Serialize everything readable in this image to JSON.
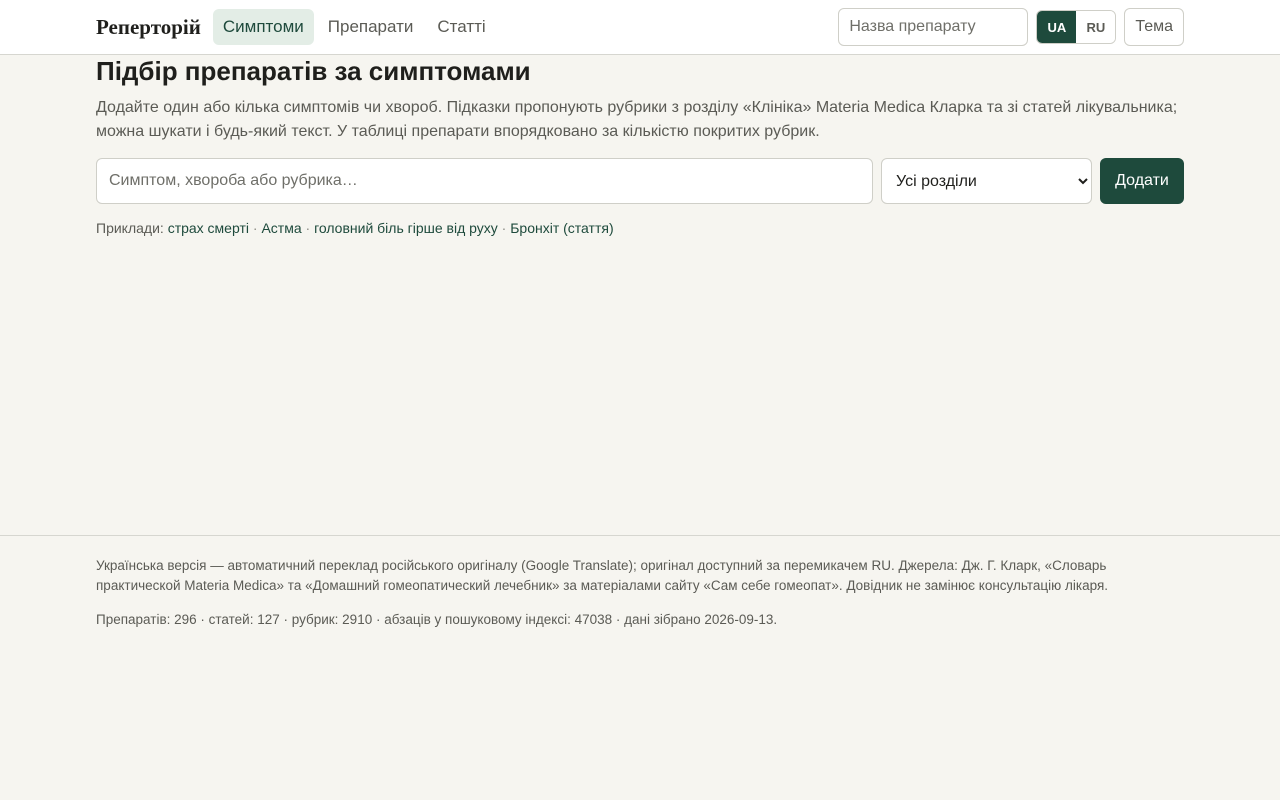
{
  "header": {
    "brand": "Реперторій",
    "nav": [
      {
        "label": "Симптоми",
        "active": true
      },
      {
        "label": "Препарати",
        "active": false
      },
      {
        "label": "Статті",
        "active": false
      }
    ],
    "medicine_search": {
      "placeholder": "Назва препарату",
      "value": ""
    },
    "languages": [
      {
        "label": "UA",
        "active": true
      },
      {
        "label": "RU",
        "active": false
      }
    ],
    "theme_label": "Тема"
  },
  "main": {
    "title": "Підбір препаратів за симптомами",
    "lead": "Додайте один або кілька симптомів чи хвороб. Підказки пропонують рубрики з розділу «Клініка» Materia Medica Кларка та зі статей лікувальника; можна шукати і будь-який текст. У таблиці препарати впорядковано за кількістю покритих рубрик.",
    "symptom_input": {
      "placeholder": "Симптом, хвороба або рубрика…",
      "value": ""
    },
    "section_select": {
      "selected": "Усі розділи"
    },
    "add_label": "Додати",
    "examples_label": "Приклади:",
    "examples": [
      "страх смерті",
      "Астма",
      "головний біль гірше від руху",
      "Бронхіт (стаття)"
    ],
    "separator": "·"
  },
  "footer": {
    "note": "Українська версія — автоматичний переклад російського оригіналу (Google Translate); оригінал доступний за перемикачем RU. Джерела: Дж. Г. Кларк, «Словарь практической Materia Medica» та «Домашний гомеопатический лечебник» за матеріалами сайту «Сам себе гомеопат». Довідник не замінює консультацію лікаря.",
    "stats": "Препаратів: 296 · статей: 127 · рубрик: 2910 · абзаців у пошуковому індексі: 47038 · дані зібрано 2026-09-13."
  },
  "colors": {
    "accent": "#1e4a3c",
    "background": "#f6f5f0",
    "active_nav_bg": "#e3ede6"
  }
}
